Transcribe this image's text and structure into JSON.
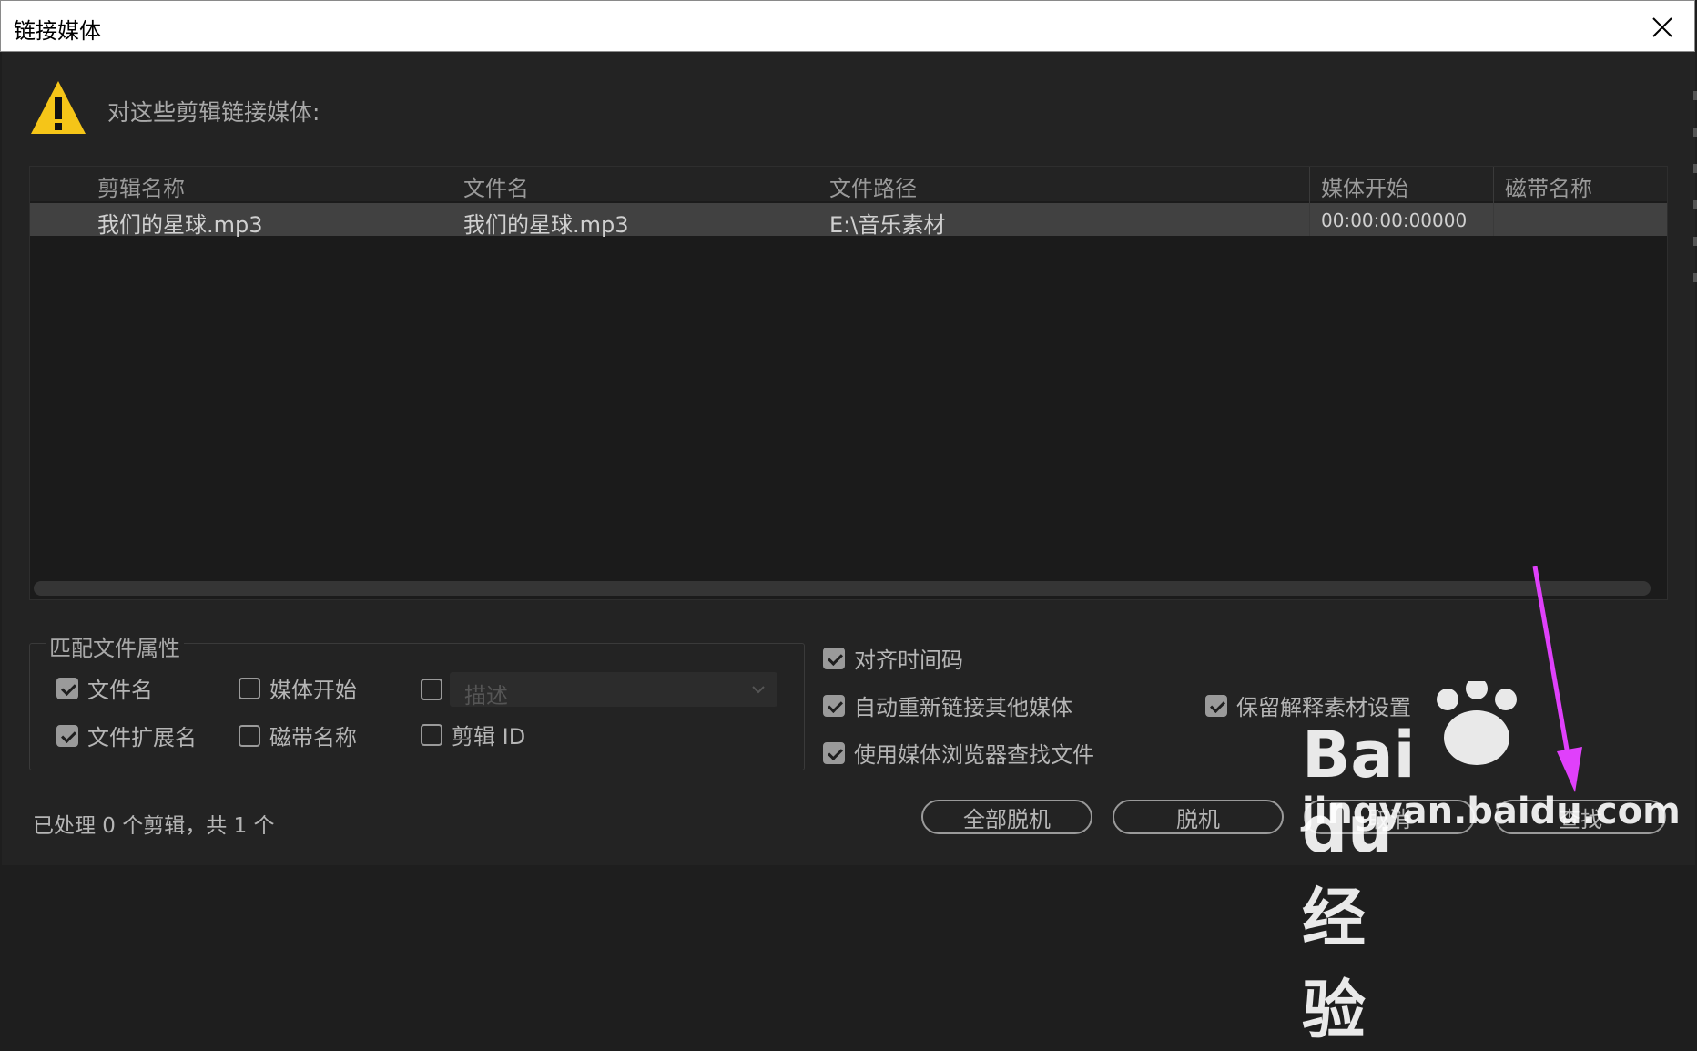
{
  "window": {
    "title": "链接媒体"
  },
  "warning": {
    "text": "对这些剪辑链接媒体:"
  },
  "table": {
    "columns": [
      "剪辑名称",
      "文件名",
      "文件路径",
      "媒体开始",
      "磁带名称"
    ],
    "rows": [
      {
        "clip_name": "我们的星球.mp3",
        "file_name": "我们的星球.mp3",
        "file_path": "E:\\音乐素材",
        "media_start": "00:00:00:00000",
        "tape_name": ""
      }
    ]
  },
  "match": {
    "title": "匹配文件属性",
    "file_name": {
      "label": "文件名",
      "checked": true
    },
    "file_ext": {
      "label": "文件扩展名",
      "checked": true
    },
    "media_start": {
      "label": "媒体开始",
      "checked": false
    },
    "tape_name": {
      "label": "磁带名称",
      "checked": false
    },
    "description": {
      "label": "描述",
      "checked": false
    },
    "clip_id": {
      "label": "剪辑 ID",
      "checked": false
    }
  },
  "options": {
    "align_timecode": {
      "label": "对齐时间码",
      "checked": true
    },
    "auto_relink": {
      "label": "自动重新链接其他媒体",
      "checked": true
    },
    "use_browser": {
      "label": "使用媒体浏览器查找文件",
      "checked": true
    },
    "preserve_interpret": {
      "label": "保留解释素材设置",
      "checked": true
    }
  },
  "status": "已处理 0 个剪辑，共 1 个",
  "buttons": {
    "offline_all": "全部脱机",
    "offline": "脱机",
    "cancel": "取消",
    "locate": "查找"
  },
  "watermark": {
    "brand": "Bai du 经验",
    "url": "jingyan.baidu.com"
  },
  "colors": {
    "background": "#232323",
    "row_selected": "#414141",
    "warning": "#f5c518",
    "arrow": "#e040fb"
  }
}
